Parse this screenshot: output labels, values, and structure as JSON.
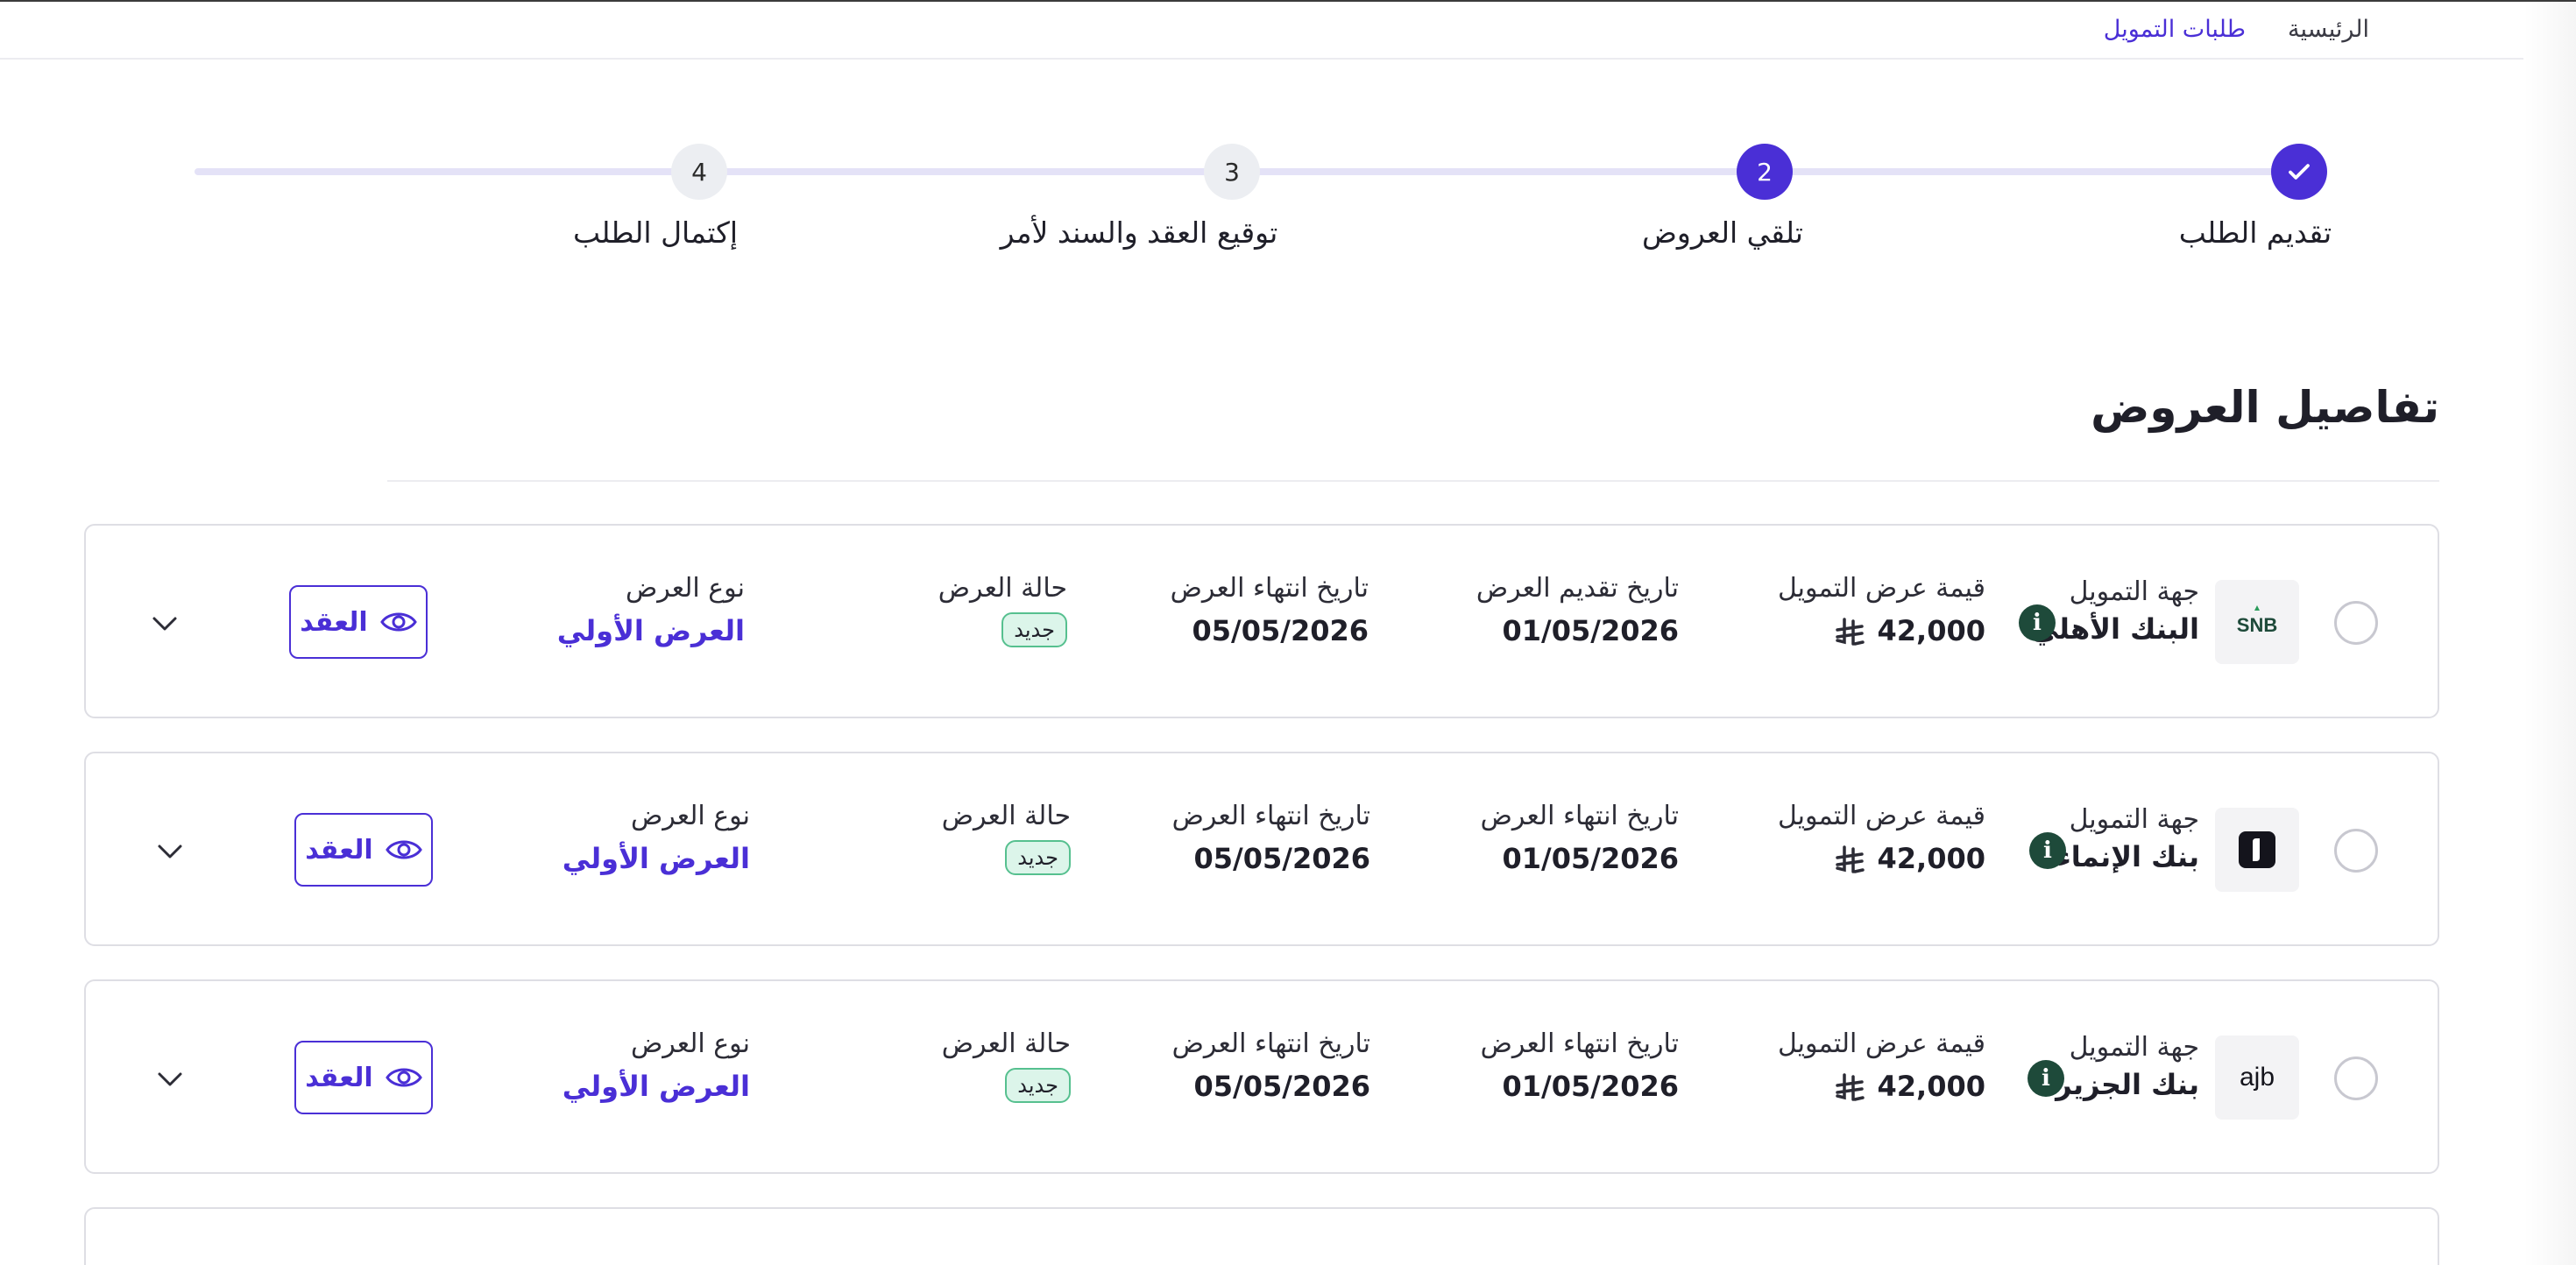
{
  "breadcrumb": {
    "home": "الرئيسية",
    "current": "طلبات التمويل"
  },
  "stepper": {
    "steps": [
      {
        "number": "✓",
        "label": "تقديم الطلب",
        "state": "done"
      },
      {
        "number": "2",
        "label": "تلقي العروض",
        "state": "active"
      },
      {
        "number": "3",
        "label": "توقيع العقد والسند لأمر",
        "state": "pending"
      },
      {
        "number": "4",
        "label": "إكتمال الطلب",
        "state": "pending"
      }
    ]
  },
  "section": {
    "title": "تفاصيل العروض"
  },
  "offers": [
    {
      "lender_label": "جهة التمويل",
      "lender_name": "البنك الأهلي",
      "logo": "SNB",
      "amount_label": "قيمة عرض التمويل",
      "amount": "42,000",
      "submit_label": "تاريخ تقديم العرض",
      "submit_date": "01/05/2026",
      "expiry_label": "تاريخ انتهاء العرض",
      "expiry_date": "05/05/2026",
      "status_label": "حالة العرض",
      "status": "جديد",
      "type_label": "نوع العرض",
      "type": "العرض الأولي",
      "contract_button": "العقد"
    },
    {
      "lender_label": "جهة التمويل",
      "lender_name": "بنك الإنماء",
      "logo": "alinma-icon",
      "amount_label": "قيمة عرض التمويل",
      "amount": "42,000",
      "submit_label": "تاريخ انتهاء العرض",
      "submit_date": "01/05/2026",
      "expiry_label": "تاريخ انتهاء العرض",
      "expiry_date": "05/05/2026",
      "status_label": "حالة العرض",
      "status": "جديد",
      "type_label": "نوع العرض",
      "type": "العرض الأولي",
      "contract_button": "العقد"
    },
    {
      "lender_label": "جهة التمويل",
      "lender_name": "بنك الجزيرة",
      "logo": "ajb",
      "amount_label": "قيمة عرض التمويل",
      "amount": "42,000",
      "submit_label": "تاريخ انتهاء العرض",
      "submit_date": "01/05/2026",
      "expiry_label": "تاريخ انتهاء العرض",
      "expiry_date": "05/05/2026",
      "status_label": "حالة العرض",
      "status": "جديد",
      "type_label": "نوع العرض",
      "type": "العرض الأولي",
      "contract_button": "العقد"
    }
  ],
  "colors": {
    "accent": "#4a2fd6",
    "info_icon": "#1e4a3a",
    "badge_bg": "#dcf5ea",
    "badge_border": "#56c08f"
  },
  "icons": [
    "check-icon",
    "info-icon",
    "eye-icon",
    "chevron-down-icon",
    "riyal-icon"
  ]
}
